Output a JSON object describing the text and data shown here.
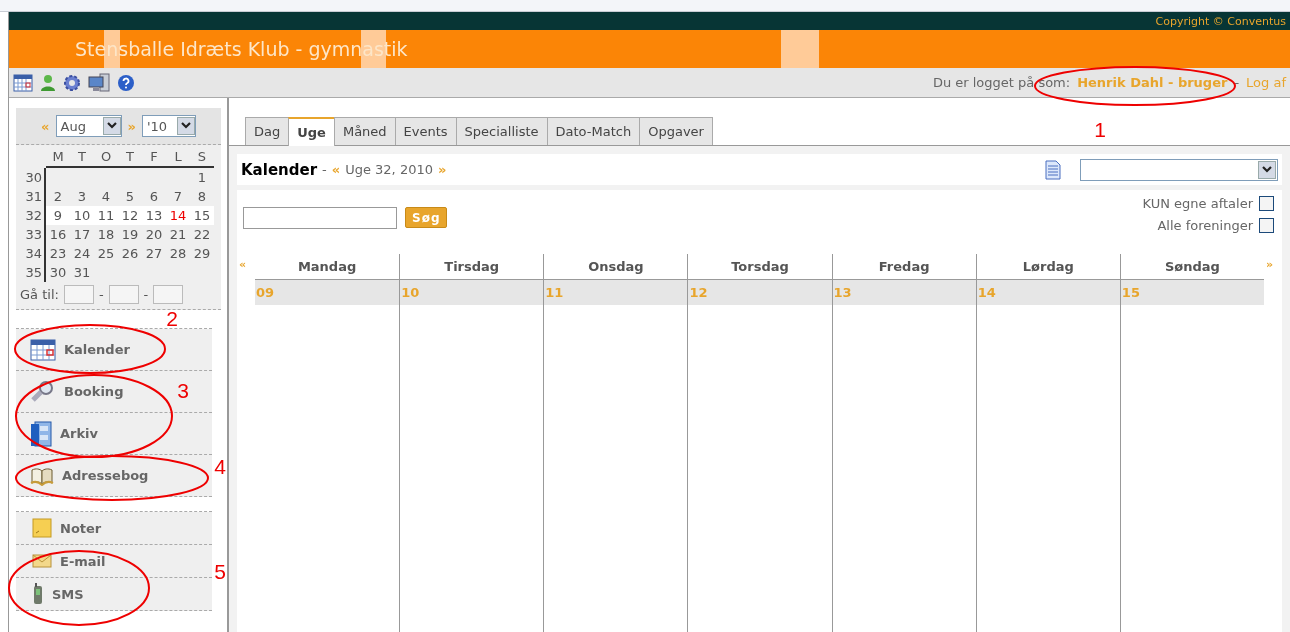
{
  "top_bar": {
    "copyright": "Copyright © Conventus"
  },
  "header": {
    "title": "Stensballe Idræts Klub - gymnastik"
  },
  "toolbar": {
    "login_prefix": "Du er logget på som:",
    "user": "Henrik Dahl - bruger",
    "separator": "-",
    "logout": "Log af"
  },
  "mini_calendar": {
    "prev": "«",
    "month": "Aug",
    "next": "»",
    "year": "'10",
    "weekdays": [
      "M",
      "T",
      "O",
      "T",
      "F",
      "L",
      "S"
    ],
    "weeks": [
      {
        "week": "30",
        "selected": false,
        "days": [
          "1"
        ]
      },
      {
        "week": "31",
        "selected": false,
        "days": [
          "2",
          "3",
          "4",
          "5",
          "6",
          "7",
          "8"
        ]
      },
      {
        "week": "32",
        "selected": true,
        "days": [
          "9",
          "10",
          "11",
          "12",
          "13",
          {
            "day": "14",
            "today": true
          },
          "15"
        ]
      },
      {
        "week": "33",
        "selected": false,
        "days": [
          "16",
          "17",
          "18",
          "19",
          "20",
          "21",
          "22"
        ]
      },
      {
        "week": "34",
        "selected": false,
        "days": [
          "23",
          "24",
          "25",
          "26",
          "27",
          "28",
          "29"
        ]
      },
      {
        "week": "35",
        "selected": false,
        "days": [
          "30",
          "31"
        ]
      }
    ],
    "goto_label": "Gå til:",
    "goto_separators": [
      "-",
      "-"
    ]
  },
  "nav_groups": [
    {
      "items": [
        {
          "label": "Kalender"
        },
        {
          "label": "Booking"
        },
        {
          "label": "Arkiv"
        },
        {
          "label": "Adressebog"
        }
      ]
    },
    {
      "items": [
        {
          "label": "Noter"
        },
        {
          "label": "E-mail"
        },
        {
          "label": "SMS"
        }
      ]
    }
  ],
  "tabs": [
    {
      "label": "Dag",
      "selected": false
    },
    {
      "label": "Uge",
      "selected": true
    },
    {
      "label": "Måned",
      "selected": false
    },
    {
      "label": "Events",
      "selected": false
    },
    {
      "label": "Specialliste",
      "selected": false
    },
    {
      "label": "Dato-Match",
      "selected": false
    },
    {
      "label": "Opgaver",
      "selected": false
    }
  ],
  "calendar": {
    "title": "Kalender",
    "dash": "-",
    "prev": "«",
    "week_label": "Uge 32, 2010",
    "next": "»",
    "search_button": "Søg",
    "filters": [
      {
        "label": "KUN egne aftaler",
        "checked": false
      },
      {
        "label": "Alle foreninger",
        "checked": false
      }
    ],
    "grid_prev": "«",
    "grid_next": "»",
    "days": [
      {
        "name": "Mandag",
        "date": "09"
      },
      {
        "name": "Tirsdag",
        "date": "10"
      },
      {
        "name": "Onsdag",
        "date": "11"
      },
      {
        "name": "Torsdag",
        "date": "12"
      },
      {
        "name": "Fredag",
        "date": "13"
      },
      {
        "name": "Lørdag",
        "date": "14"
      },
      {
        "name": "Søndag",
        "date": "15"
      }
    ]
  },
  "annotations": [
    {
      "label": "1"
    },
    {
      "label": "2"
    },
    {
      "label": "3"
    },
    {
      "label": "4"
    },
    {
      "label": "5"
    }
  ]
}
